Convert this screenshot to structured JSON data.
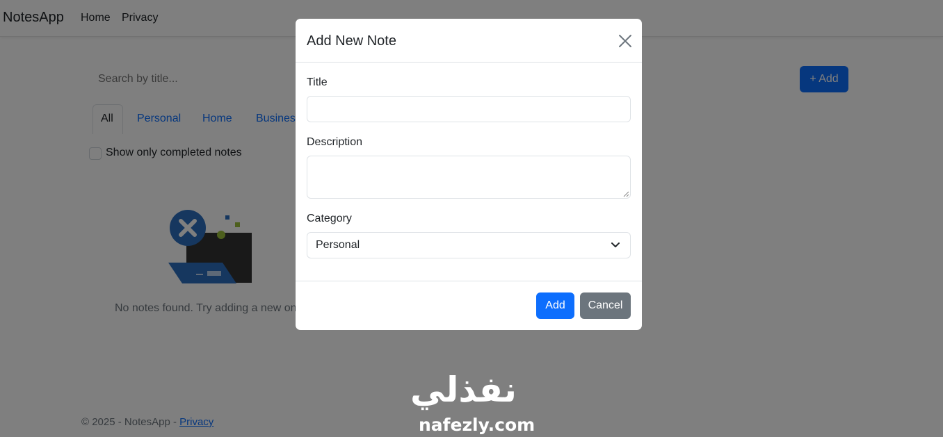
{
  "navbar": {
    "brand": "NotesApp",
    "links": [
      "Home",
      "Privacy"
    ]
  },
  "toolbar": {
    "search_placeholder": "Search by title...",
    "add_label": "+ Add"
  },
  "tabs": [
    "All",
    "Personal",
    "Home",
    "Business"
  ],
  "filter": {
    "completed_label": "Show only completed notes",
    "checked": false
  },
  "empty_state": {
    "message": "No notes found. Try adding a new on"
  },
  "footer": {
    "copyright": "© 2025 - NotesApp - ",
    "privacy_link": "Privacy"
  },
  "modal": {
    "title": "Add New Note",
    "title_label": "Title",
    "title_value": "",
    "description_label": "Description",
    "description_value": "",
    "category_label": "Category",
    "category_value": "Personal",
    "add_label": "Add",
    "cancel_label": "Cancel"
  },
  "watermark": {
    "arabic": "نفذلي",
    "latin": "nafezly.com"
  },
  "colors": {
    "primary": "#0d6efd",
    "secondary": "#6c757d",
    "backdrop": "rgba(0,0,0,0.5)"
  }
}
